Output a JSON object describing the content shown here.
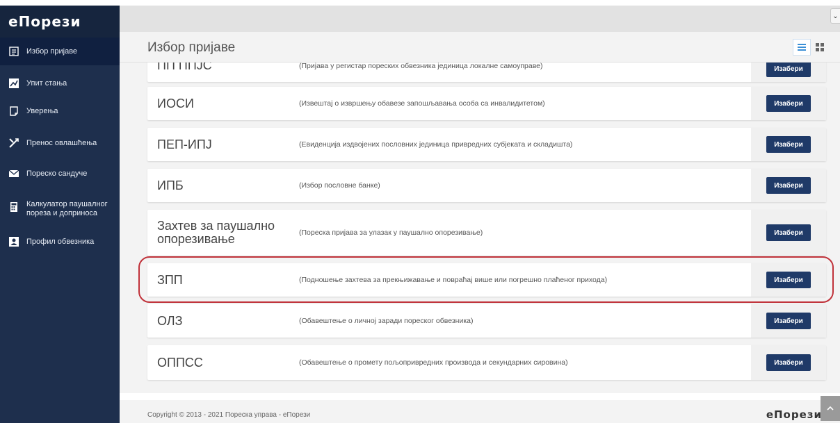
{
  "app": {
    "brand": "еПорези"
  },
  "sidebar": {
    "items": [
      {
        "label": "Избор пријаве",
        "icon": "list-box-icon",
        "active": true
      },
      {
        "label": "Упит стања",
        "icon": "chart-icon",
        "active": false
      },
      {
        "label": "Уверења",
        "icon": "certificate-icon",
        "active": false
      },
      {
        "label": "Пренос овлашћења",
        "icon": "transfer-icon",
        "active": false
      },
      {
        "label": "Пореско сандуче",
        "icon": "mail-icon",
        "active": false
      },
      {
        "label": "Калкулатор паушалног пореза и доприноса",
        "icon": "calculator-icon",
        "active": false
      },
      {
        "label": "Профил обвезника",
        "icon": "profile-icon",
        "active": false
      }
    ]
  },
  "header": {
    "title": "Избор пријаве"
  },
  "button_label": "Изабери",
  "rows": [
    {
      "code": "ПП ППЈС",
      "desc": "(Пријава у регистар пореских обвезника јединица локалне самоуправе)"
    },
    {
      "code": "ИОСИ",
      "desc": "(Извештај о извршењу обавезе запошљавања особа са инвалидитетом)"
    },
    {
      "code": "ПЕП-ИПЈ",
      "desc": "(Евиденција издвојених пословних јединица привредних субјеката и складишта)"
    },
    {
      "code": "ИПБ",
      "desc": "(Избор пословне банке)"
    },
    {
      "code": "Захтев за паушално опорезивање",
      "desc": "(Пореска пријава за улазак у паушално опорезивање)"
    },
    {
      "code": "ЗПП",
      "desc": "(Подношење захтева за прекњижавање и повраћај више или погрешно плаћеног прихода)"
    },
    {
      "code": "ОЛЗ",
      "desc": "(Обавештење о личној заради пореског обвезника)"
    },
    {
      "code": "ОППСС",
      "desc": "(Обавештење о промету пољопривредних производа и секундарних сировина)"
    }
  ],
  "footer": {
    "copyright": "Copyright © 2013 - 2021 Пореска управа - еПорези",
    "brand": "еПорези"
  },
  "colors": {
    "sidebar": "#1e2f4d",
    "button": "#1f3a68",
    "highlight": "#c0323a"
  }
}
